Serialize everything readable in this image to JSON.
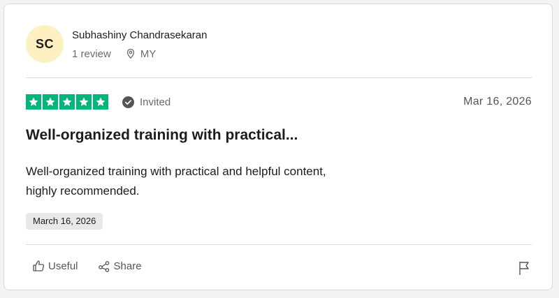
{
  "colors": {
    "star_green": "#00b67a",
    "avatar_bg": "#fdf1c2",
    "badge_bg": "#e8e8e6"
  },
  "reviewer": {
    "initials": "SC",
    "name": "Subhashiny Chandrasekaran",
    "review_count": "1 review",
    "country": "MY"
  },
  "review": {
    "rating": 5,
    "max_rating": 5,
    "status": "Invited",
    "date": "Mar 16, 2026",
    "title": "Well-organized training with practical...",
    "body_line1": "Well-organized training with practical and helpful content,",
    "body_line2": "highly recommended.",
    "experience_date": "March 16, 2026"
  },
  "actions": {
    "useful_label": "Useful",
    "share_label": "Share"
  },
  "icons": {
    "location": "location-pin-icon",
    "verified": "check-circle-icon",
    "useful": "thumbs-up-icon",
    "share": "share-icon",
    "report": "flag-icon"
  }
}
